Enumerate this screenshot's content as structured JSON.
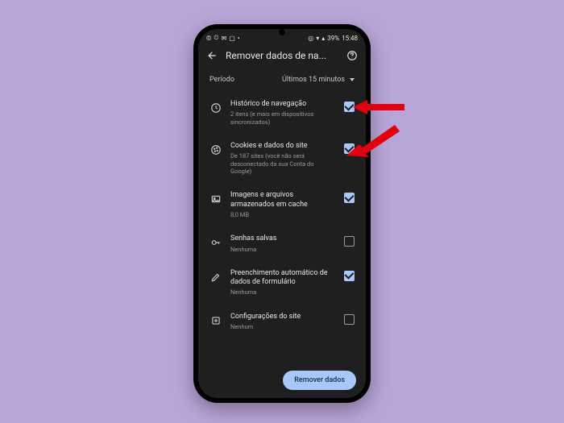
{
  "status": {
    "left_icons": [
      "©",
      "⏲",
      "✉",
      "▢",
      "•"
    ],
    "right_icons": [
      "◎",
      "▾",
      "▴"
    ],
    "battery": "39%",
    "time": "15:48"
  },
  "header": {
    "title": "Remover dados de na..."
  },
  "period": {
    "label": "Período",
    "value": "Últimos 15 minutos"
  },
  "items": [
    {
      "title": "Histórico de navegação",
      "sub": "2 itens (e mais em dispositivos sincronizados)",
      "checked": true
    },
    {
      "title": "Cookies e dados do site",
      "sub": "De 187 sites (você não será desconectado da sua Conta do Google)",
      "checked": true
    },
    {
      "title": "Imagens e arquivos armazenados em cache",
      "sub": "8,0 MB",
      "checked": true
    },
    {
      "title": "Senhas salvas",
      "sub": "Nenhuma",
      "checked": false
    },
    {
      "title": "Preenchimento automático de dados de formulário",
      "sub": "Nenhuma",
      "checked": true
    },
    {
      "title": "Configurações do site",
      "sub": "Nenhum",
      "checked": false
    }
  ],
  "button": {
    "label": "Remover dados"
  }
}
